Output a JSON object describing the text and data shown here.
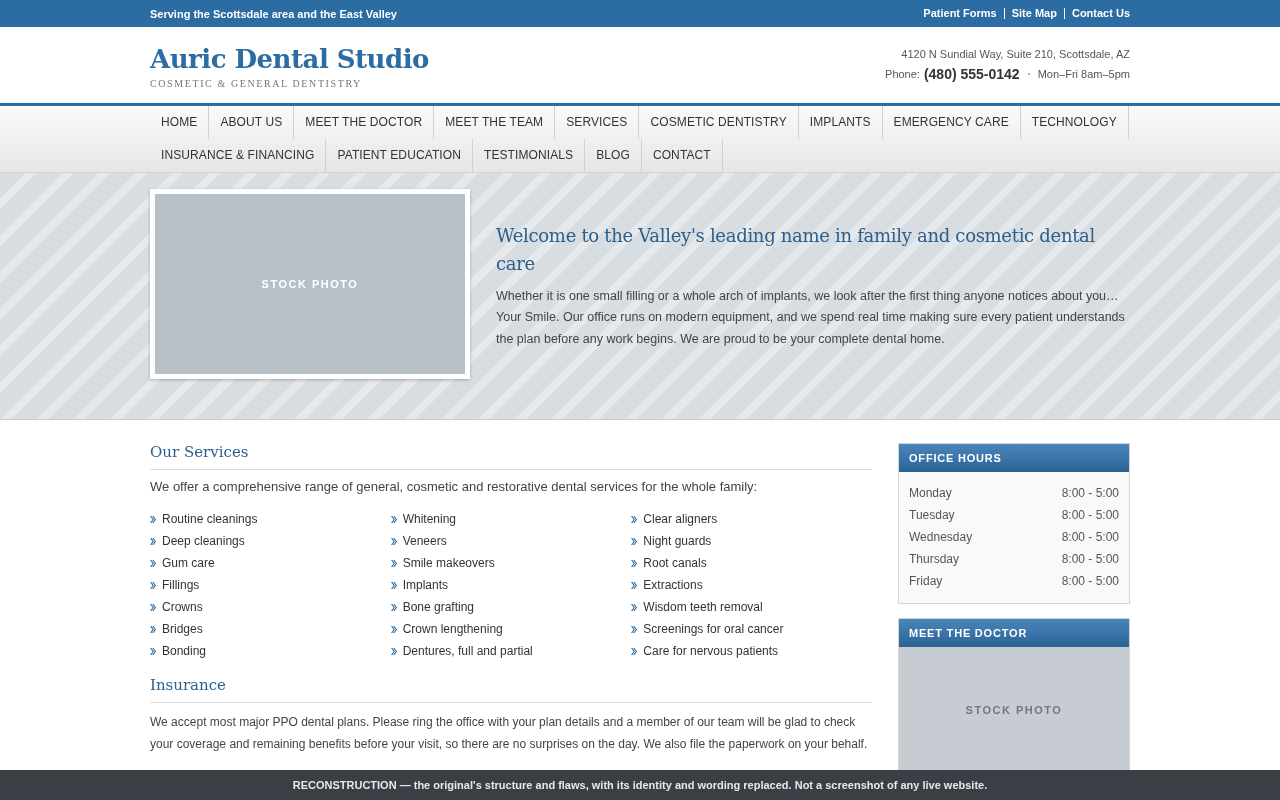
{
  "top_bar": {
    "tagline": "Serving the Scottsdale area and the East Valley",
    "links": [
      "Patient Forms",
      "Site Map",
      "Contact Us"
    ]
  },
  "header": {
    "logo": "Auric Dental Studio",
    "subtitle": "COSMETIC & GENERAL DENTISTRY",
    "address": "4120 N Sundial Way, Suite 210, Scottsdale, AZ",
    "phone_label": "Phone:",
    "phone": "(480) 555-0142",
    "hours": "Mon–Fri 8am–5pm"
  },
  "nav": {
    "items": [
      "HOME",
      "ABOUT US",
      "MEET THE DOCTOR",
      "MEET THE TEAM",
      "SERVICES",
      "COSMETIC DENTISTRY",
      "IMPLANTS",
      "EMERGENCY CARE",
      "TECHNOLOGY",
      "INSURANCE & FINANCING",
      "PATIENT EDUCATION",
      "TESTIMONIALS",
      "BLOG",
      "CONTACT"
    ]
  },
  "hero": {
    "photo_label": "STOCK PHOTO",
    "heading": "Welcome to the Valley's leading name in family and cosmetic dental care",
    "text": "Whether it is one small filling or a whole arch of implants, we look after the first thing anyone notices about you…Your Smile. Our office runs on modern equipment, and we spend real time making sure every patient understands the plan before any work begins. We are proud to be your complete dental home."
  },
  "services": {
    "heading": "Our Services",
    "intro": "We offer a comprehensive range of general, cosmetic and restorative dental services for the whole family:",
    "columns": [
      [
        "Routine cleanings",
        "Deep cleanings",
        "Gum care",
        "Fillings",
        "Crowns",
        "Bridges",
        "Bonding"
      ],
      [
        "Whitening",
        "Veneers",
        "Smile makeovers",
        "Implants",
        "Bone grafting",
        "Crown lengthening",
        "Dentures, full and partial"
      ],
      [
        "Clear aligners",
        "Night guards",
        "Root canals",
        "Extractions",
        "Wisdom teeth removal",
        "Screenings for oral cancer",
        "Care for nervous patients"
      ]
    ]
  },
  "insurance": {
    "heading": "Insurance",
    "text": "We accept most major PPO dental plans. Please ring the office with your plan details and a member of our team will be glad to check your coverage and remaining benefits before your visit, so there are no surprises on the day. We also file the paperwork on your behalf."
  },
  "office_hours": {
    "title": "OFFICE HOURS",
    "rows": [
      {
        "day": "Monday",
        "time": "8:00 - 5:00"
      },
      {
        "day": "Tuesday",
        "time": "8:00 - 5:00"
      },
      {
        "day": "Wednesday",
        "time": "8:00 - 5:00"
      },
      {
        "day": "Thursday",
        "time": "8:00 - 5:00"
      },
      {
        "day": "Friday",
        "time": "8:00 - 5:00"
      }
    ]
  },
  "meet_doctor": {
    "title": "MEET THE DOCTOR",
    "photo_label": "STOCK PHOTO"
  },
  "notice_bar": {
    "text": "RECONSTRUCTION — the original's structure and flaws, with its identity and wording replaced. Not a screenshot of any live website."
  }
}
